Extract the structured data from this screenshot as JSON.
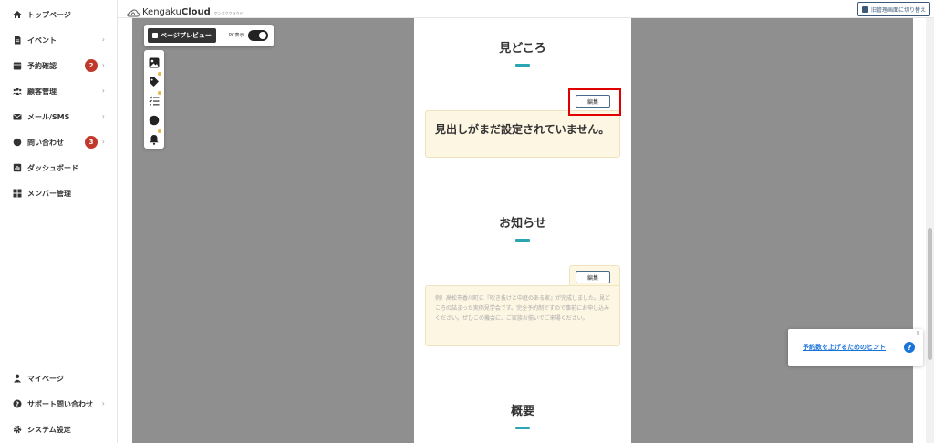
{
  "sidebar": {
    "items": [
      {
        "label": "トップページ",
        "icon": "home-icon",
        "chevron": false
      },
      {
        "label": "イベント",
        "icon": "document-icon",
        "chevron": true
      },
      {
        "label": "予約確認",
        "icon": "calendar-icon",
        "chevron": true,
        "badge": "2"
      },
      {
        "label": "顧客管理",
        "icon": "users-icon",
        "chevron": true
      },
      {
        "label": "メール/SMS",
        "icon": "mail-icon",
        "chevron": true
      },
      {
        "label": "問い合わせ",
        "icon": "chat-icon",
        "chevron": true,
        "badge": "3"
      },
      {
        "label": "ダッシュボード",
        "icon": "chart-icon",
        "chevron": false
      },
      {
        "label": "メンバー管理",
        "icon": "grid-icon",
        "chevron": false
      }
    ],
    "bottom_items": [
      {
        "label": "マイページ",
        "icon": "person-icon",
        "chevron": false
      },
      {
        "label": "サポート問い合わせ",
        "icon": "help-icon",
        "chevron": true
      },
      {
        "label": "システム設定",
        "icon": "gear-icon",
        "chevron": false
      }
    ],
    "chevron_glyph": "›"
  },
  "header": {
    "logo_text_light": "Kengaku",
    "logo_text_bold": "Cloud",
    "logo_sub": "ケンガククラウド",
    "switch_label": "旧管理画面に切り替え"
  },
  "preview_toolbar": {
    "preview_label": "ページプレビュー",
    "pc_label": "PC表示",
    "tools": [
      "image-icon",
      "tag-icon",
      "checklist-icon",
      "chat-bubble-icon",
      "bell-icon"
    ]
  },
  "page": {
    "sections": [
      {
        "title": "見どころ"
      },
      {
        "title": "お知らせ"
      },
      {
        "title": "概要"
      }
    ],
    "highlight_card": {
      "edit_label": "編集",
      "heading": "見出しがまだ設定されていません。"
    },
    "news_card": {
      "edit_label": "編集",
      "placeholder": "例）高松市香川町に『吹き抜けと中庭のある家』が完成しました。見どころの詰まった実例見学会です。完全予約制ですので事前にお申し込みください。ぜひこの機会に、ご家族お揃いでご来場ください。"
    }
  },
  "hint": {
    "link_label": "予約数を上げるためのヒント",
    "help_glyph": "?",
    "close_glyph": "×"
  },
  "colors": {
    "accent": "#2aa6b3",
    "badge": "#c0392b",
    "highlight_box": "#e00000",
    "link": "#1a73d9",
    "canvas": "#8f8f8f"
  }
}
